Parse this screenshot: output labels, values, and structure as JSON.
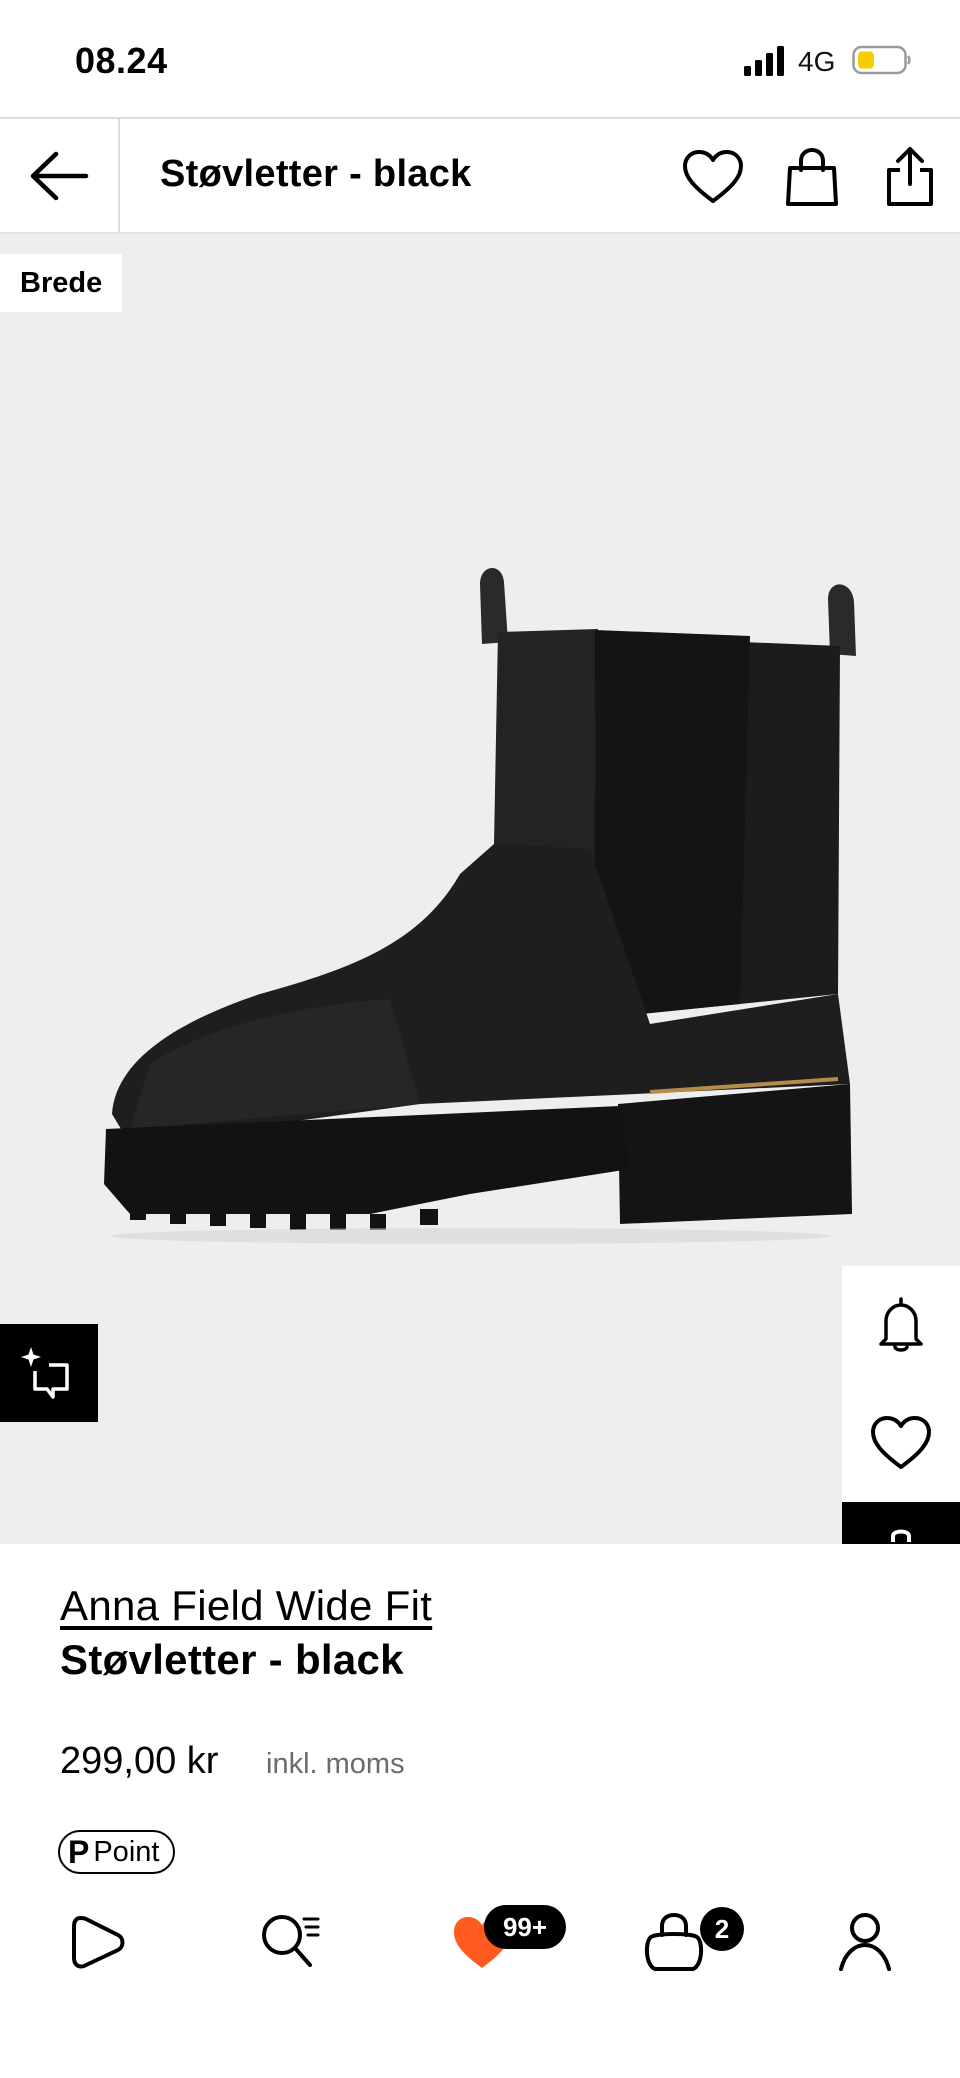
{
  "status_bar": {
    "time": "08.24",
    "network": "4G"
  },
  "header": {
    "title": "Støvletter - black"
  },
  "product_image": {
    "badge": "Brede"
  },
  "product": {
    "brand": "Anna Field Wide Fit",
    "name": "Støvletter - black",
    "price": "299,00 kr",
    "vat_note": "inkl. moms",
    "points_label": "Point",
    "points_symbol": "P"
  },
  "bottom_nav": {
    "wishlist_count": "99+",
    "bag_count": "2"
  },
  "colors": {
    "wishlist_heart": "#ff5a1f",
    "battery_level": "#f5cc00",
    "image_background": "#eeeeee"
  }
}
